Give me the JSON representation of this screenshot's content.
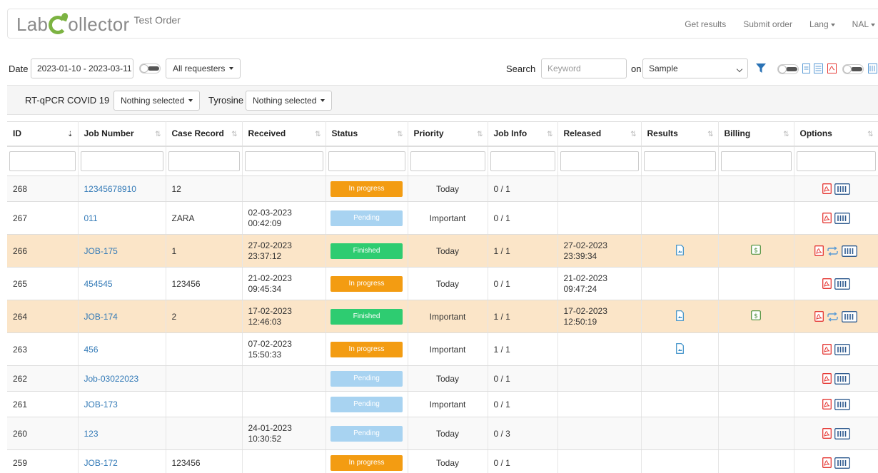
{
  "header": {
    "brand": {
      "lab": "Lab",
      "collector": "ollector",
      "subtitle": "Test Order"
    },
    "nav": {
      "get_results": "Get results",
      "submit_order": "Submit order",
      "lang": "Lang",
      "user": "NAL"
    }
  },
  "filters": {
    "date_label": "Date",
    "date_value": "2023-01-10 - 2023-03-11",
    "requesters": "All requesters",
    "search_label": "Search",
    "search_placeholder": "Keyword",
    "on_label": "on",
    "on_value": "Sample",
    "rtqpcr_label": "RT-qPCR COVID 19",
    "rtqpcr_value": "Nothing selected",
    "tyrosine_label": "Tyrosine",
    "tyrosine_value": "Nothing selected"
  },
  "table": {
    "headers": [
      "ID",
      "Job Number",
      "Case Record",
      "Received",
      "Status",
      "Priority",
      "Job Info",
      "Released",
      "Results",
      "Billing",
      "Options"
    ],
    "rows": [
      {
        "id": "268",
        "job": "12345678910",
        "case": "12",
        "received_date": "",
        "received_time": "",
        "status": "In progress",
        "priority": "Today",
        "info": "0 / 1",
        "released_date": "",
        "released_time": "",
        "results": false,
        "billing": false,
        "repeat": false
      },
      {
        "id": "267",
        "job": "011",
        "case": "ZARA",
        "received_date": "02-03-2023",
        "received_time": "00:42:09",
        "status": "Pending",
        "priority": "Important",
        "info": "0 / 1",
        "released_date": "",
        "released_time": "",
        "results": false,
        "billing": false,
        "repeat": false
      },
      {
        "id": "266",
        "job": "JOB-175",
        "case": "1",
        "received_date": "27-02-2023",
        "received_time": "23:37:12",
        "status": "Finished",
        "priority": "Today",
        "info": "1 / 1",
        "released_date": "27-02-2023",
        "released_time": "23:39:34",
        "results": true,
        "billing": true,
        "repeat": true
      },
      {
        "id": "265",
        "job": "454545",
        "case": "123456",
        "received_date": "21-02-2023",
        "received_time": "09:45:34",
        "status": "In progress",
        "priority": "Today",
        "info": "0 / 1",
        "released_date": "21-02-2023",
        "released_time": "09:47:24",
        "results": false,
        "billing": false,
        "repeat": false
      },
      {
        "id": "264",
        "job": "JOB-174",
        "case": "2",
        "received_date": "17-02-2023",
        "received_time": "12:46:03",
        "status": "Finished",
        "priority": "Important",
        "info": "1 / 1",
        "released_date": "17-02-2023",
        "released_time": "12:50:19",
        "results": true,
        "billing": true,
        "repeat": true
      },
      {
        "id": "263",
        "job": "456",
        "case": "",
        "received_date": "07-02-2023",
        "received_time": "15:50:33",
        "status": "In progress",
        "priority": "Important",
        "info": "1 / 1",
        "released_date": "",
        "released_time": "",
        "results": true,
        "billing": false,
        "repeat": false
      },
      {
        "id": "262",
        "job": "Job-03022023",
        "case": "",
        "received_date": "",
        "received_time": "",
        "status": "Pending",
        "priority": "Today",
        "info": "0 / 1",
        "released_date": "",
        "released_time": "",
        "results": false,
        "billing": false,
        "repeat": false
      },
      {
        "id": "261",
        "job": "JOB-173",
        "case": "",
        "received_date": "",
        "received_time": "",
        "status": "Pending",
        "priority": "Important",
        "info": "0 / 1",
        "released_date": "",
        "released_time": "",
        "results": false,
        "billing": false,
        "repeat": false
      },
      {
        "id": "260",
        "job": "123",
        "case": "",
        "received_date": "24-01-2023",
        "received_time": "10:30:52",
        "status": "Pending",
        "priority": "Today",
        "info": "0 / 3",
        "released_date": "",
        "released_time": "",
        "results": false,
        "billing": false,
        "repeat": false
      },
      {
        "id": "259",
        "job": "JOB-172",
        "case": "123456",
        "received_date": "",
        "received_time": "",
        "status": "In progress",
        "priority": "Today",
        "info": "0 / 1",
        "released_date": "",
        "released_time": "",
        "results": false,
        "billing": false,
        "repeat": false
      }
    ]
  },
  "colors": {
    "in_progress": "#f39c12",
    "pending": "#a8d3f1",
    "finished": "#2ecc71",
    "highlight_row": "#fbe5c8",
    "link": "#337ab7",
    "brand_green": "#7cb342"
  },
  "icons": [
    "pdf-icon",
    "barcode-icon",
    "repeat-icon",
    "result-file-icon",
    "billing-icon",
    "filter-funnel-icon"
  ]
}
